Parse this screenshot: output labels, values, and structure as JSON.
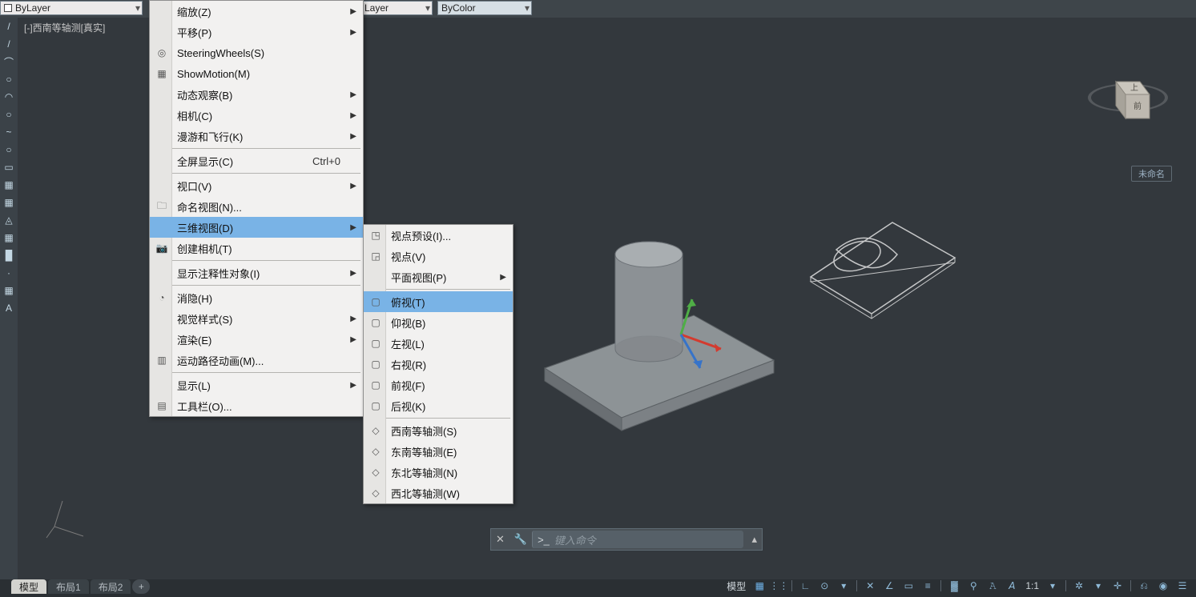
{
  "topbar": {
    "bylayer": "ByLayer",
    "layer": "Layer",
    "bycolor": "ByColor"
  },
  "viewport": {
    "label": "[-]西南等轴测[真实]"
  },
  "viewcube": {
    "face_top": "上",
    "face_right": "前",
    "unnamed": "未命名"
  },
  "menu1": [
    {
      "label": "缩放(Z)",
      "arrow": true
    },
    {
      "label": "平移(P)",
      "arrow": true
    },
    {
      "label": "SteeringWheels(S)",
      "icon": "◎"
    },
    {
      "label": "ShowMotion(M)",
      "icon": "▦"
    },
    {
      "label": "动态观察(B)",
      "arrow": true
    },
    {
      "label": "相机(C)",
      "arrow": true
    },
    {
      "label": "漫游和飞行(K)",
      "arrow": true
    },
    {
      "sep": true
    },
    {
      "label": "全屏显示(C)",
      "shortcut": "Ctrl+0"
    },
    {
      "sep": true
    },
    {
      "label": "视口(V)",
      "arrow": true
    },
    {
      "label": "命名视图(N)...",
      "icon": "🗀"
    },
    {
      "label": "三维视图(D)",
      "arrow": true,
      "hl": true
    },
    {
      "label": "创建相机(T)",
      "icon": "📷"
    },
    {
      "sep": true
    },
    {
      "label": "显示注释性对象(I)",
      "arrow": true
    },
    {
      "sep": true
    },
    {
      "label": "消隐(H)",
      "icon": "◔"
    },
    {
      "label": "视觉样式(S)",
      "arrow": true
    },
    {
      "label": "渲染(E)",
      "arrow": true
    },
    {
      "label": "运动路径动画(M)...",
      "icon": "▥"
    },
    {
      "sep": true
    },
    {
      "label": "显示(L)",
      "arrow": true
    },
    {
      "label": "工具栏(O)...",
      "icon": "▤"
    }
  ],
  "menu2": [
    {
      "label": "视点预设(I)...",
      "icon": "◳"
    },
    {
      "label": "视点(V)",
      "icon": "◲"
    },
    {
      "label": "平面视图(P)",
      "arrow": true
    },
    {
      "sep": true
    },
    {
      "label": "俯视(T)",
      "icon": "▢",
      "hl": true
    },
    {
      "label": "仰视(B)",
      "icon": "▢"
    },
    {
      "label": "左视(L)",
      "icon": "▢"
    },
    {
      "label": "右视(R)",
      "icon": "▢"
    },
    {
      "label": "前视(F)",
      "icon": "▢"
    },
    {
      "label": "后视(K)",
      "icon": "▢"
    },
    {
      "sep": true
    },
    {
      "label": "西南等轴测(S)",
      "icon": "◇"
    },
    {
      "label": "东南等轴测(E)",
      "icon": "◇"
    },
    {
      "label": "东北等轴测(N)",
      "icon": "◇"
    },
    {
      "label": "西北等轴测(W)",
      "icon": "◇"
    }
  ],
  "cmd": {
    "placeholder": "键入命令",
    "icon_prefix": ">_"
  },
  "tabs": {
    "model": "模型",
    "layout1": "布局1",
    "layout2": "布局2",
    "add": "+"
  },
  "status": {
    "model": "模型",
    "ratio": "1:1"
  },
  "lefttools": [
    "/",
    "/",
    "⌒",
    "○",
    "◠",
    "○",
    "~",
    "○",
    "▭",
    "▦",
    "▦",
    "◬",
    "▦",
    "█",
    "·",
    "▦",
    "A"
  ]
}
